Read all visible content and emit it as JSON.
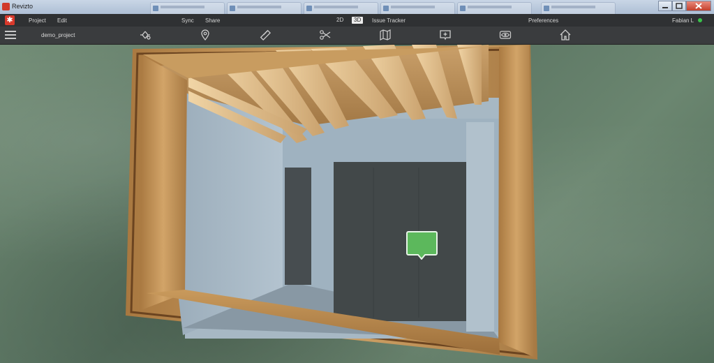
{
  "window": {
    "title": "Revizto"
  },
  "menu": {
    "project": "Project",
    "edit": "Edit",
    "sync": "Sync",
    "share": "Share",
    "mode_2d": "2D",
    "mode_3d": "3D",
    "issue_tracker": "Issue Tracker",
    "preferences": "Preferences",
    "user": "Fabian L",
    "connection_color": "#39c24a"
  },
  "toolbar": {
    "project_name": "demo_project",
    "tools": [
      "navigation-mode-icon",
      "location-pin-icon",
      "measure-ruler-icon",
      "section-cut-icon",
      "map-icon",
      "add-issue-icon",
      "visibility-eye-icon",
      "home-icon"
    ]
  },
  "viewport": {
    "issue_marker_color": "#5cb85c"
  }
}
